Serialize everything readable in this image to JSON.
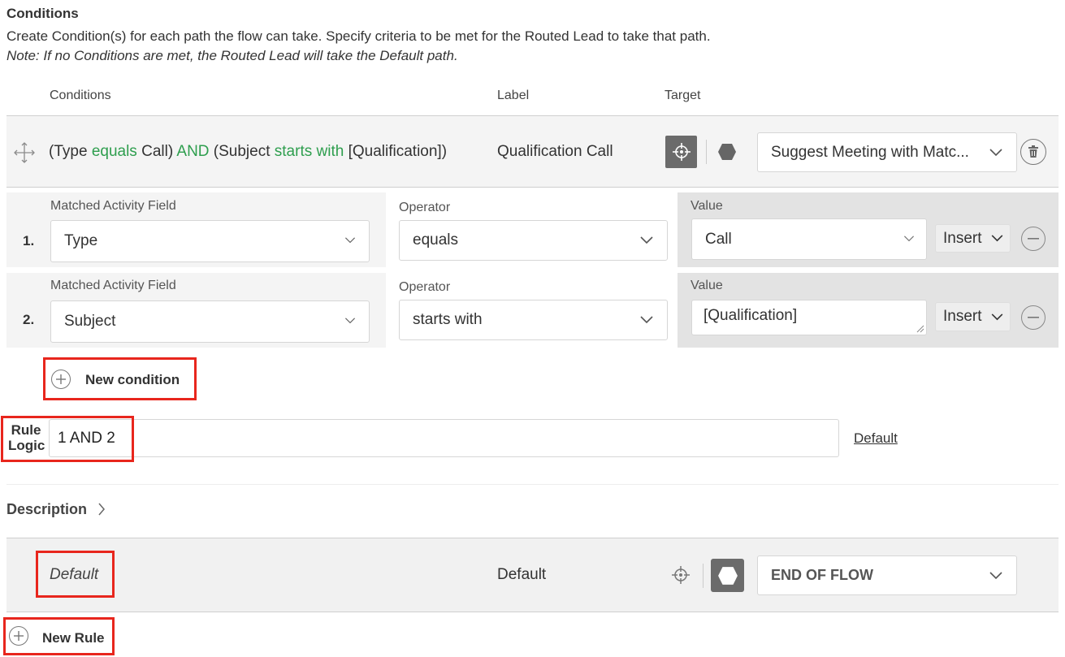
{
  "section": {
    "title": "Conditions",
    "description": "Create Condition(s) for each path the flow can take. Specify criteria to be met for the Routed Lead to take that path.",
    "note": "Note: If no Conditions are met, the Routed Lead will take the Default path."
  },
  "columns": {
    "conditions": "Conditions",
    "label": "Label",
    "target": "Target"
  },
  "rule": {
    "summary_parts": [
      "(Type ",
      "equals",
      " Call) ",
      "AND",
      " (Subject ",
      "starts with",
      " [Qualification])"
    ],
    "label": "Qualification Call",
    "target_value": "Suggest Meeting with Matc..."
  },
  "conditions": [
    {
      "number": "1.",
      "field_label": "Matched Activity Field",
      "field_value": "Type",
      "operator_label": "Operator",
      "operator_value": "equals",
      "value_label": "Value",
      "value": "Call",
      "insert_label": "Insert"
    },
    {
      "number": "2.",
      "field_label": "Matched Activity Field",
      "field_value": "Subject",
      "operator_label": "Operator",
      "operator_value": "starts with",
      "value_label": "Value",
      "value": "[Qualification]",
      "insert_label": "Insert"
    }
  ],
  "new_condition_label": "New condition",
  "rule_logic": {
    "label": "Rule Logic",
    "value": "1 AND 2",
    "default_link": "Default"
  },
  "description_toggle": "Description",
  "default_rule": {
    "name": "Default",
    "label": "Default",
    "target_value": "END OF FLOW"
  },
  "new_rule_label": "New Rule",
  "colors": {
    "keyword_green": "#2e9e4e",
    "highlight_red": "#e8261d",
    "active_button_gray": "#6b6b6b"
  }
}
